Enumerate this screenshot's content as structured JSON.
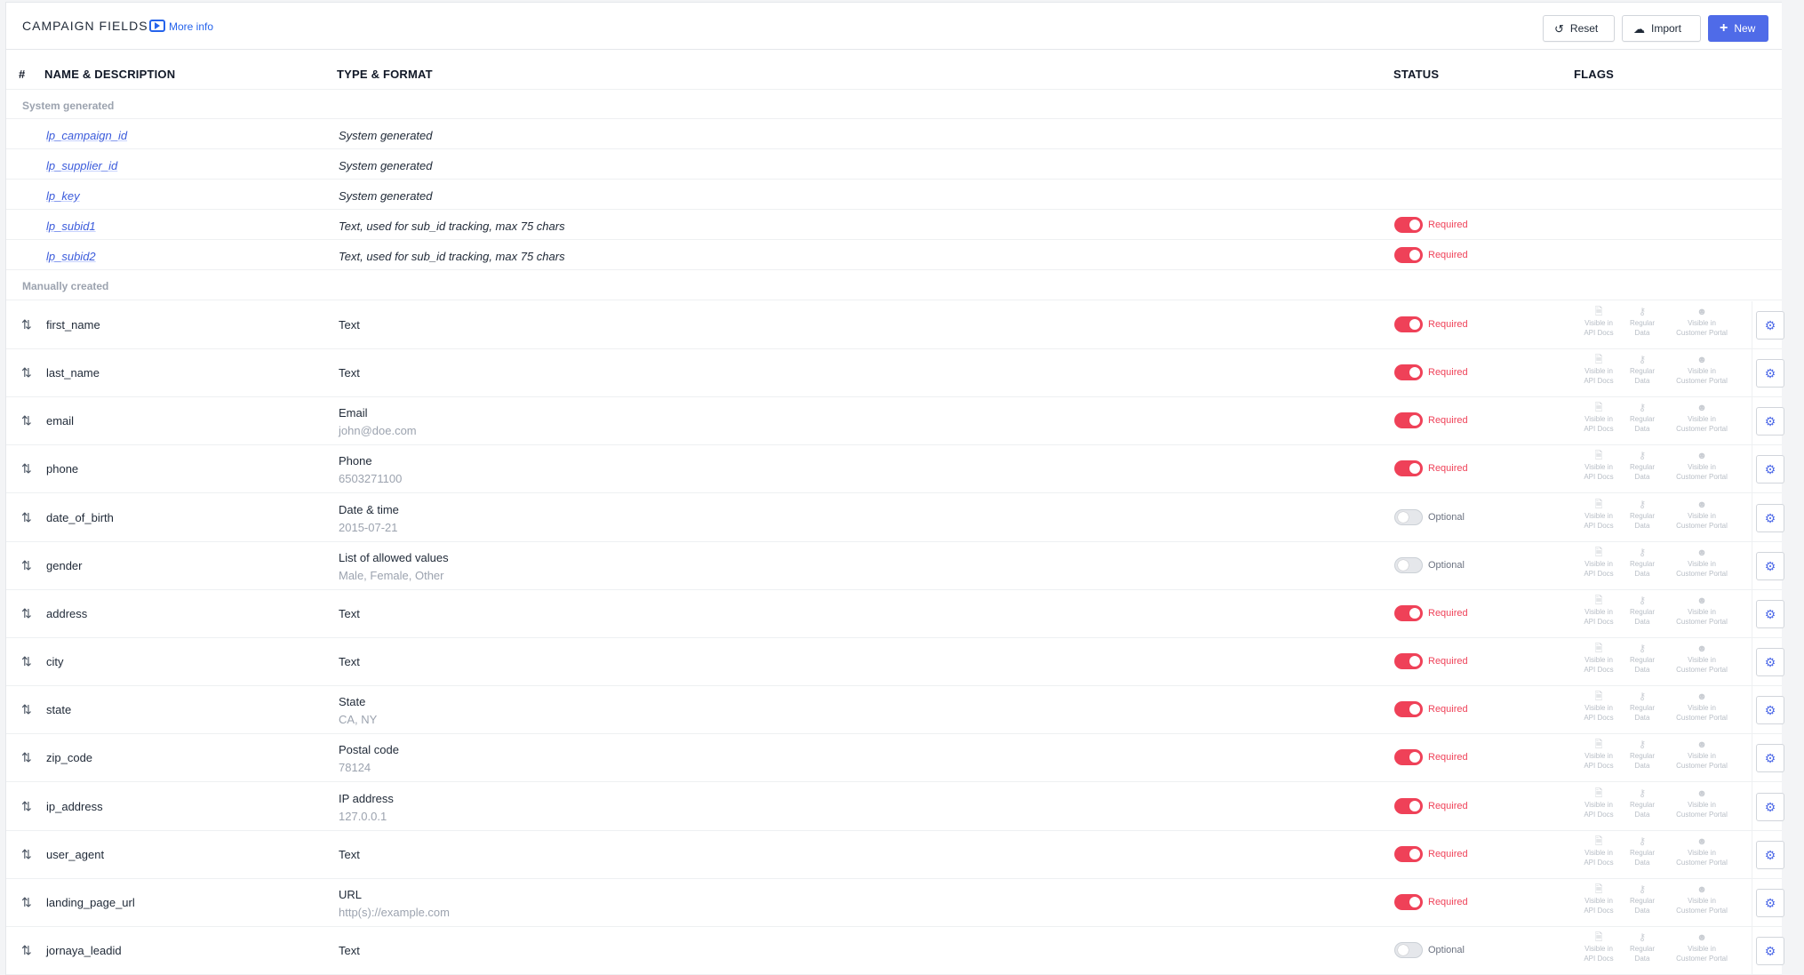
{
  "header": {
    "title": "CAMPAIGN FIELDS",
    "more_info": "More info",
    "reset_label": "Reset",
    "import_label": "Import",
    "new_label": "New"
  },
  "table_headers": {
    "num": "#",
    "name": "NAME & DESCRIPTION",
    "type": "TYPE & FORMAT",
    "status": "STATUS",
    "flags": "FLAGS"
  },
  "groups": {
    "system": "System generated",
    "manual": "Manually created"
  },
  "flag_labels": {
    "api_1": "Visible in",
    "api_2": "API Docs",
    "reg_1": "Regular",
    "reg_2": "Data",
    "cust_1": "Visible in",
    "cust_2": "Customer Portal"
  },
  "system_fields": [
    {
      "name": "lp_campaign_id",
      "type": "System generated",
      "status": ""
    },
    {
      "name": "lp_supplier_id",
      "type": "System generated",
      "status": ""
    },
    {
      "name": "lp_key",
      "type": "System generated",
      "status": ""
    },
    {
      "name": "lp_subid1",
      "type": "Text, used for sub_id tracking, max 75 chars",
      "status": "Required"
    },
    {
      "name": "lp_subid2",
      "type": "Text, used for sub_id tracking, max 75 chars",
      "status": "Required"
    }
  ],
  "manual_fields": [
    {
      "name": "first_name",
      "type": "Text",
      "example": "",
      "status": "Required"
    },
    {
      "name": "last_name",
      "type": "Text",
      "example": "",
      "status": "Required"
    },
    {
      "name": "email",
      "type": "Email",
      "example": "john@doe.com",
      "status": "Required"
    },
    {
      "name": "phone",
      "type": "Phone",
      "example": "6503271100",
      "status": "Required"
    },
    {
      "name": "date_of_birth",
      "type": "Date & time",
      "example": "2015-07-21",
      "status": "Optional"
    },
    {
      "name": "gender",
      "type": "List of allowed values",
      "example": "Male, Female, Other",
      "status": "Optional"
    },
    {
      "name": "address",
      "type": "Text",
      "example": "",
      "status": "Required"
    },
    {
      "name": "city",
      "type": "Text",
      "example": "",
      "status": "Required"
    },
    {
      "name": "state",
      "type": "State",
      "example": "CA, NY",
      "status": "Required"
    },
    {
      "name": "zip_code",
      "type": "Postal code",
      "example": "78124",
      "status": "Required"
    },
    {
      "name": "ip_address",
      "type": "IP address",
      "example": "127.0.0.1",
      "status": "Required"
    },
    {
      "name": "user_agent",
      "type": "Text",
      "example": "",
      "status": "Required"
    },
    {
      "name": "landing_page_url",
      "type": "URL",
      "example": "http(s)://example.com",
      "status": "Required"
    },
    {
      "name": "jornaya_leadid",
      "type": "Text",
      "example": "",
      "status": "Optional"
    }
  ],
  "colors": {
    "accent": "#4f6be8",
    "required": "#ef4158",
    "link": "#3b5bdb"
  },
  "icons": {
    "reset": "reset-icon",
    "import": "cloud-upload-icon",
    "new": "plus-icon",
    "sort": "sort-arrows-icon",
    "flag_api": "document-icon",
    "flag_regular": "key-icon",
    "flag_customer": "users-icon",
    "settings": "gear-icon"
  }
}
